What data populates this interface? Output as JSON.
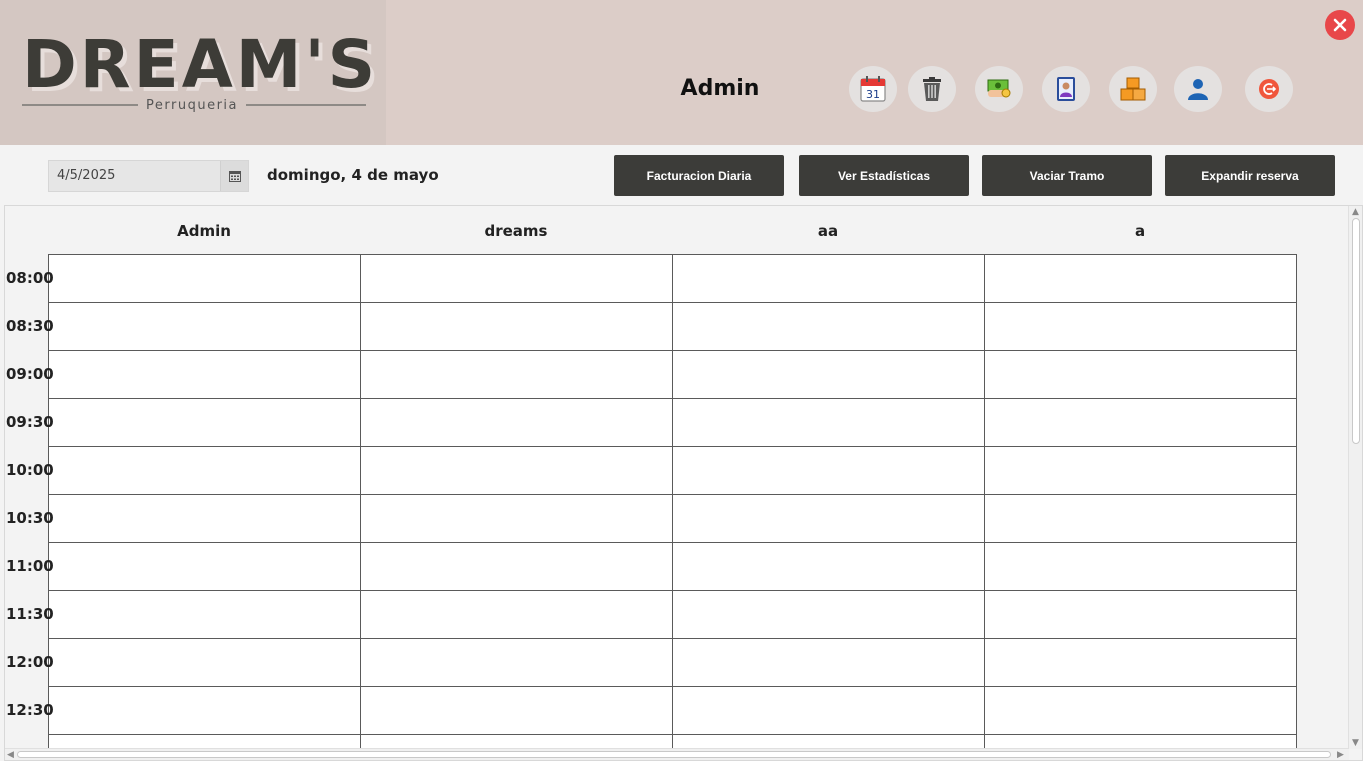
{
  "header": {
    "logo_text": "DREAM'S",
    "logo_subtitle": "Perruqueria",
    "user_name": "Admin",
    "icons": [
      "calendar-icon",
      "trash-icon",
      "money-icon",
      "contacts-icon",
      "boxes-icon",
      "user-icon",
      "logout-icon"
    ],
    "calendar_day": "31"
  },
  "toolbar": {
    "date_value": "4/5/2025",
    "date_label": "domingo, 4 de mayo",
    "buttons": {
      "daily_billing": "Facturacion Diaria",
      "statistics": "Ver Estadísticas",
      "clear_slot": "Vaciar Tramo",
      "expand_booking": "Expandir reserva"
    }
  },
  "schedule": {
    "columns": [
      "Admin",
      "dreams",
      "aa",
      "a"
    ],
    "times": [
      "08:00",
      "08:30",
      "09:00",
      "09:30",
      "10:00",
      "10:30",
      "11:00",
      "11:30",
      "12:00",
      "12:30"
    ]
  },
  "colors": {
    "header_bg": "#dccdc8",
    "button_bg": "#3c3c39",
    "close_red": "#e8474a"
  }
}
